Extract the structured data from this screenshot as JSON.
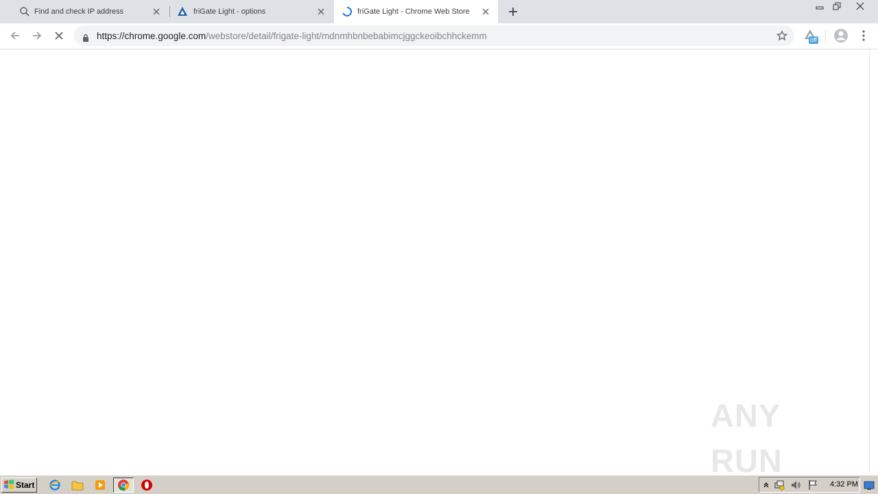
{
  "window": {
    "controls": {
      "minimize": "minimize",
      "restore": "restore",
      "close": "close"
    }
  },
  "tabs": [
    {
      "title": "Find and check IP address",
      "icon": "search-icon",
      "active": false
    },
    {
      "title": "friGate Light - options",
      "icon": "frigate-logo-icon",
      "active": false
    },
    {
      "title": "friGate Light - Chrome Web Store",
      "icon": "loading-spinner-icon",
      "active": true
    }
  ],
  "toolbar": {
    "url_host": "https://chrome.google.com",
    "url_path": "/webstore/detail/frigate-light/mdnmhbnbebabimcjggckeoibchhckemm",
    "extension_badge": "off"
  },
  "watermark": {
    "text": "ANY RUN"
  },
  "taskbar": {
    "start_label": "Start",
    "clock": "4:32 PM"
  },
  "colors": {
    "tabstrip": "#dee1e6",
    "omnibox": "#f1f3f4",
    "spinner": "#1a73e8",
    "frigate": "#1f5ea8",
    "badge": "#4aa3df",
    "taskbar": "#d4d0c8"
  }
}
